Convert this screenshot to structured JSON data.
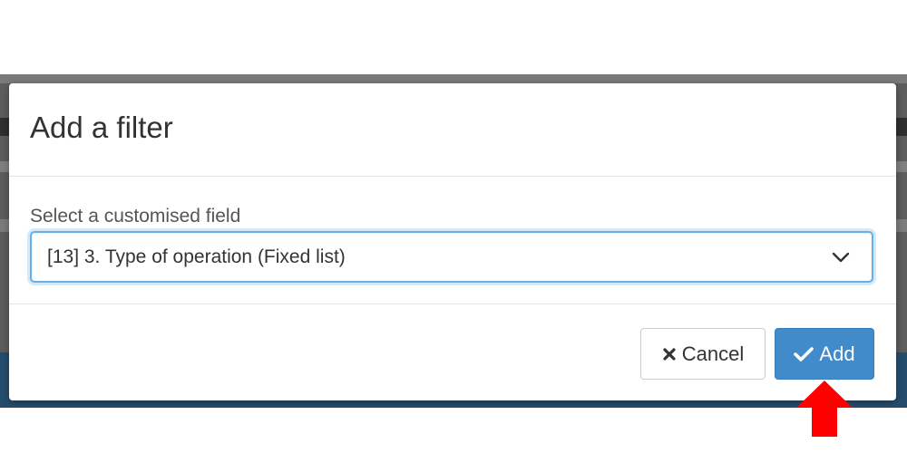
{
  "dialog": {
    "title": "Add a filter",
    "field_label": "Select a customised field",
    "select": {
      "selected_value": "[13] 3. Type of operation (Fixed list)",
      "icon": "chevron-down-icon"
    },
    "buttons": {
      "cancel": {
        "label": "Cancel",
        "icon": "times-icon"
      },
      "add": {
        "label": "Add",
        "icon": "check-icon"
      }
    }
  },
  "annotation": {
    "arrow_icon": "red-up-arrow-icon",
    "arrow_color": "#ff0000"
  },
  "colors": {
    "primary": "#428bca",
    "focus": "#66afe9",
    "backdrop": "#5d5d5d",
    "background_band": "#244d6d"
  }
}
